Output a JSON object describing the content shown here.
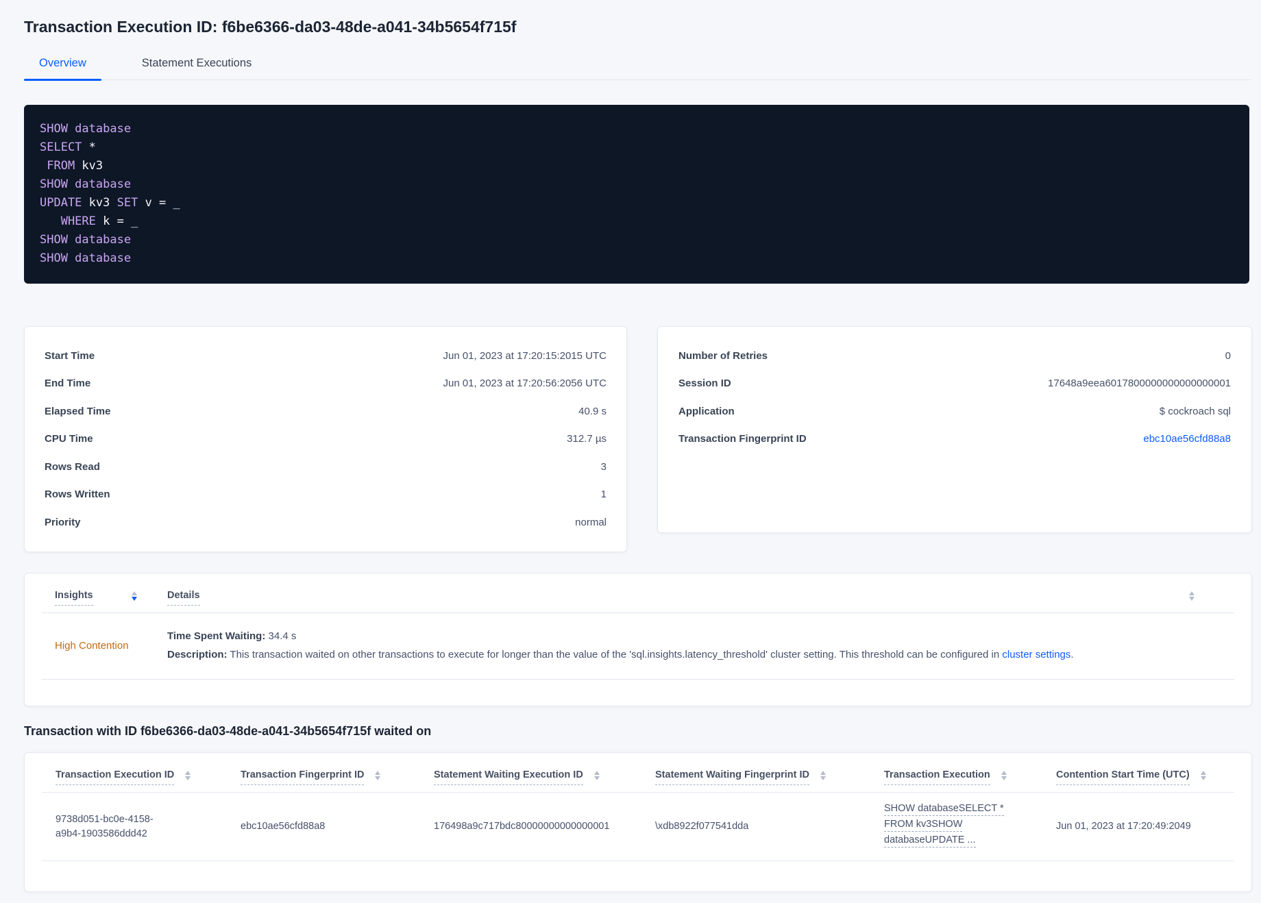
{
  "page": {
    "title": "Transaction Execution ID: f6be6366-da03-48de-a041-34b5654f715f"
  },
  "tabs": {
    "overview": "Overview",
    "statement_executions": "Statement Executions"
  },
  "colors": {
    "accent_blue": "#0b5dff",
    "code_background": "#0e1726",
    "code_keyword_purple": "#c9a6f2",
    "insight_orange": "#c06a14"
  },
  "code": {
    "lines": [
      {
        "tokens": [
          {
            "t": "SHOW database"
          }
        ]
      },
      {
        "tokens": [
          {
            "t": "SELECT"
          },
          {
            "t": " *"
          }
        ]
      },
      {
        "tokens": [
          {
            "t": " FROM"
          },
          {
            "t": " kv3"
          }
        ]
      },
      {
        "tokens": [
          {
            "t": "SHOW database"
          }
        ]
      },
      {
        "tokens": [
          {
            "t": "UPDATE"
          },
          {
            "t": " kv3 "
          },
          {
            "t": "SET"
          },
          {
            "t": " v = _"
          }
        ]
      },
      {
        "tokens": [
          {
            "t": "   WHERE"
          },
          {
            "t": " k = _"
          }
        ]
      },
      {
        "tokens": [
          {
            "t": "SHOW database"
          }
        ]
      },
      {
        "tokens": [
          {
            "t": "SHOW database"
          }
        ]
      }
    ]
  },
  "exec_card": {
    "rows": [
      {
        "label": "Start Time",
        "value": "Jun 01, 2023 at 17:20:15:2015 UTC"
      },
      {
        "label": "End Time",
        "value": "Jun 01, 2023 at 17:20:56:2056 UTC"
      },
      {
        "label": "Elapsed Time",
        "value": "40.9 s"
      },
      {
        "label": "CPU Time",
        "value": "312.7 µs"
      },
      {
        "label": "Rows Read",
        "value": "3"
      },
      {
        "label": "Rows Written",
        "value": "1"
      },
      {
        "label": "Priority",
        "value": "normal"
      }
    ]
  },
  "meta_card": {
    "rows": [
      {
        "label": "Number of Retries",
        "value": "0"
      },
      {
        "label": "Session ID",
        "value": "17648a9eea6017800000000000000001"
      },
      {
        "label": "Application",
        "value": "$ cockroach sql"
      },
      {
        "label": "Transaction Fingerprint ID",
        "value": "ebc10ae56cfd88a8"
      }
    ]
  },
  "insights": {
    "col_insights": "Insights",
    "col_details": "Details",
    "row": {
      "insight": "High Contention",
      "waiting_label": "Time Spent Waiting:",
      "waiting_value": "34.4 s",
      "description_label": "Description:",
      "description_text": "This transaction waited on other transactions to execute for longer than the value of the 'sql.insights.latency_threshold' cluster setting. This threshold can be configured in ",
      "description_link": "cluster settings",
      "description_end": "."
    }
  },
  "waited_on": {
    "heading": "Transaction with ID f6be6366-da03-48de-a041-34b5654f715f waited on",
    "columns": [
      "Transaction Execution ID",
      "Transaction Fingerprint ID",
      "Statement Waiting Execution ID",
      "Statement Waiting Fingerprint ID",
      "Transaction Execution",
      "Contention Start Time (UTC)"
    ],
    "row": {
      "transaction_execution_id": "9738d051-bc0e-4158-a9b4-1903586ddd42",
      "transaction_fingerprint_id": "ebc10ae56cfd88a8",
      "statement_waiting_execution_id": "176498a9c717bdc80000000000000001",
      "statement_waiting_fingerprint_id": "\\xdb8922f077541dda",
      "transaction_execution_lines": [
        "SHOW databaseSELECT *",
        "FROM kv3SHOW",
        "databaseUPDATE ..."
      ],
      "contention_start_time": "Jun 01, 2023 at 17:20:49:2049"
    }
  }
}
